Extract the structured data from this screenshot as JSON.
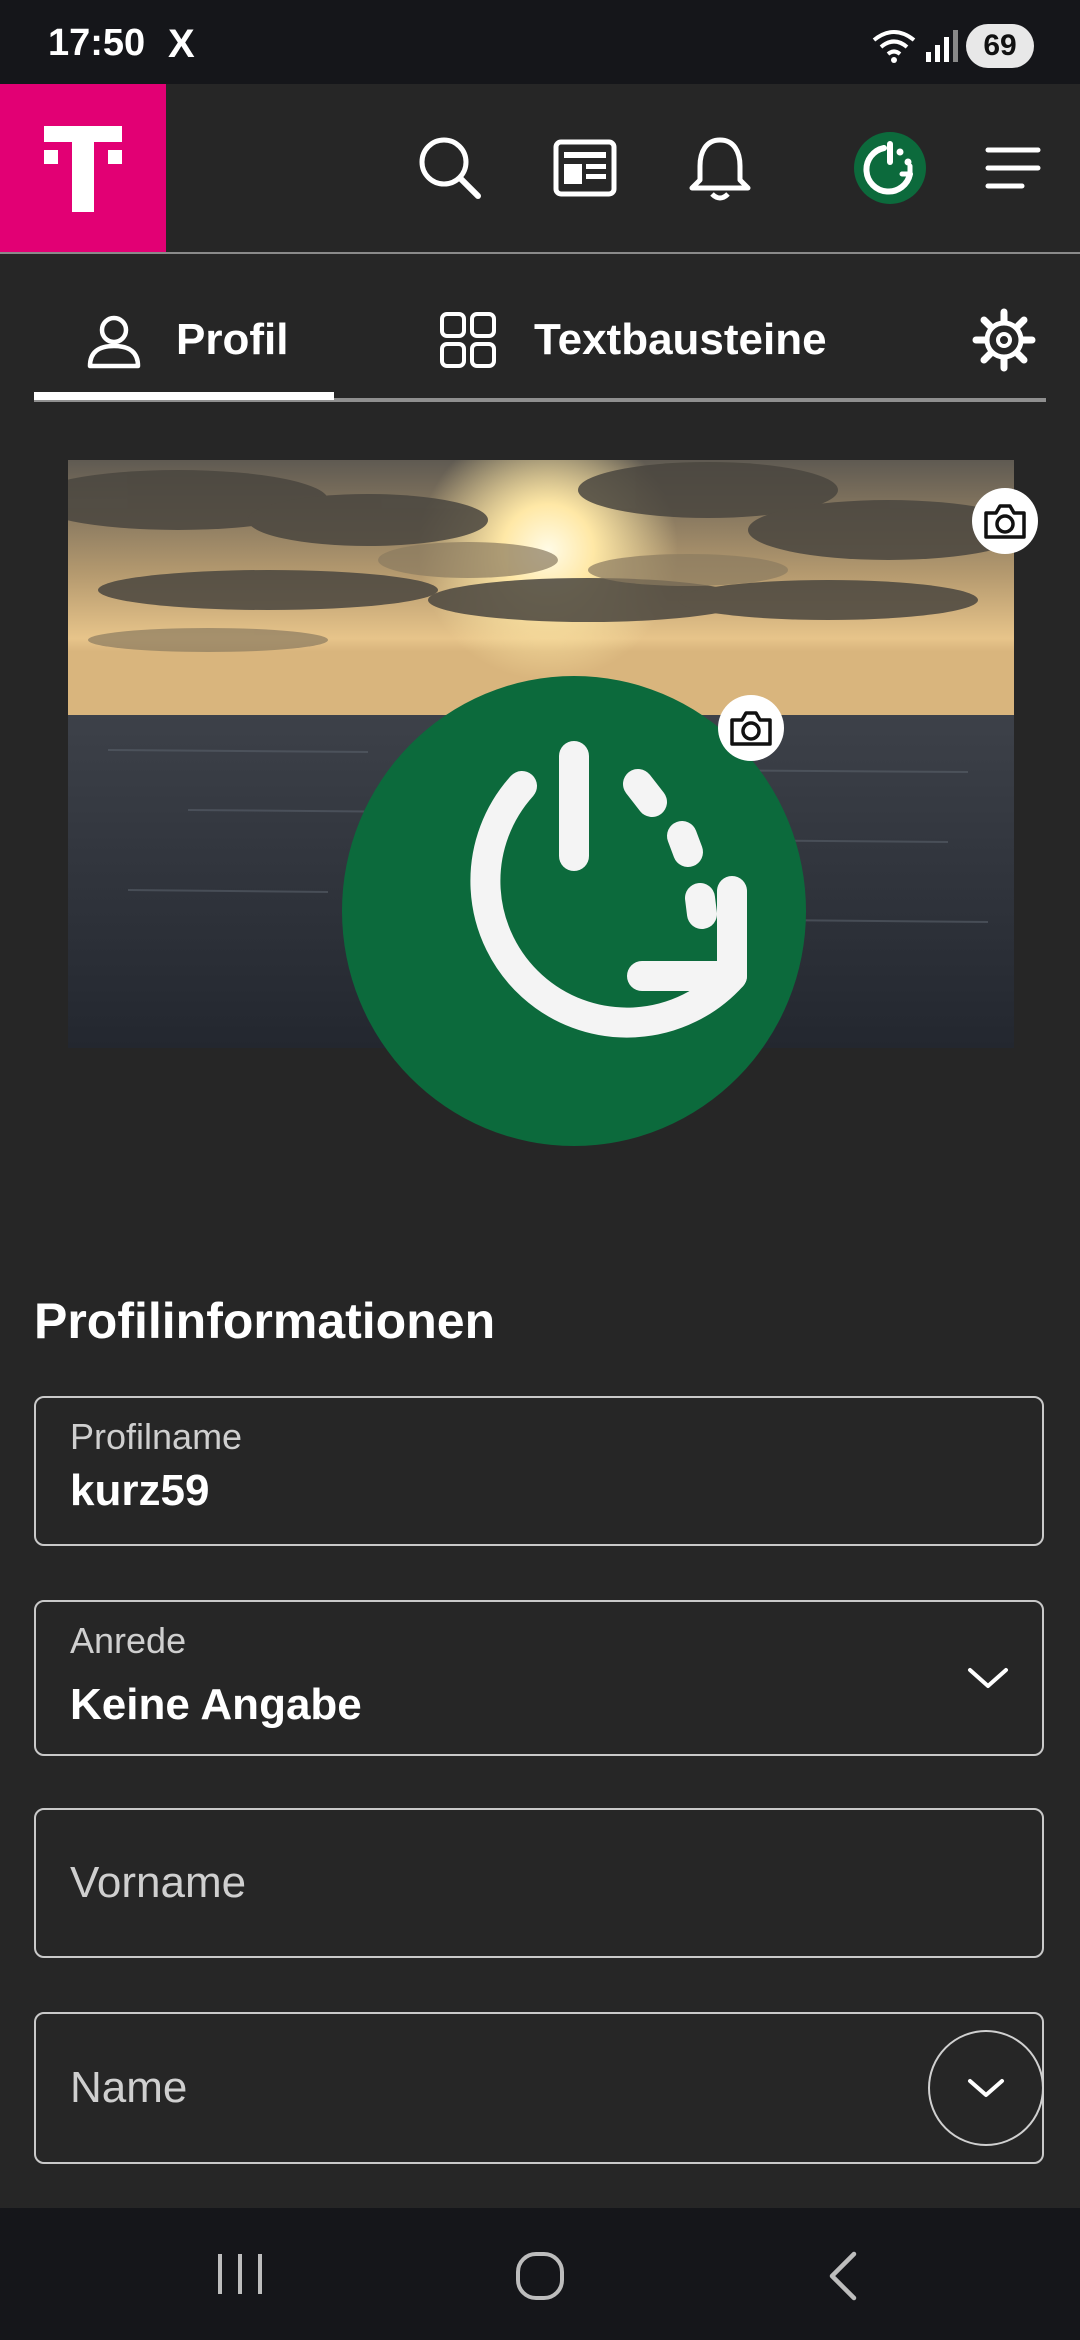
{
  "status_bar": {
    "time": "17:50",
    "app_logo": "X",
    "battery": "69"
  },
  "top_nav": {
    "logo_text": "T",
    "icons": [
      "search-icon",
      "news-icon",
      "bell-icon",
      "profile-avatar-icon",
      "menu-icon"
    ]
  },
  "tabs": [
    {
      "label": "Profil",
      "icon": "person-icon",
      "active": true
    },
    {
      "label": "Textbausteine",
      "icon": "grid-icon",
      "active": false
    },
    {
      "label": "",
      "icon": "gear-icon",
      "active": false
    }
  ],
  "profile": {
    "section_title": "Profilinformationen",
    "fields": {
      "profilname": {
        "label": "Profilname",
        "value": "kurz59"
      },
      "anrede": {
        "label": "Anrede",
        "value": "Keine Angabe"
      },
      "vorname": {
        "placeholder": "Vorname"
      },
      "name": {
        "placeholder": "Name"
      }
    }
  },
  "colors": {
    "brand": "#e20074",
    "avatar": "#0c6a3c",
    "background": "#262626"
  }
}
